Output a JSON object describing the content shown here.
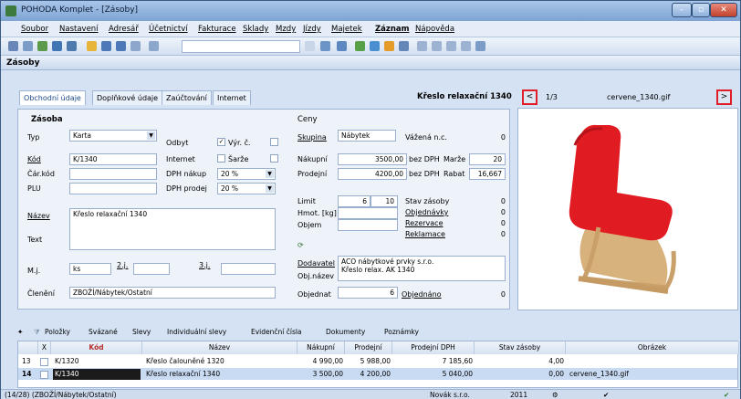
{
  "window": {
    "title": "POHODA Komplet - [Zásoby]"
  },
  "menu": [
    "Soubor",
    "Nastavení",
    "Adresář",
    "Účetnictví",
    "Fakturace",
    "Sklady",
    "Mzdy",
    "Jízdy",
    "Majetek",
    "Záznam",
    "Nápověda"
  ],
  "agenda": {
    "title": "Zásoby"
  },
  "tabs": [
    "Obchodní údaje",
    "Doplňkové údaje",
    "Zaúčtování",
    "Internet"
  ],
  "item_title": "Křeslo relaxační 1340",
  "nav": {
    "prev": "<",
    "counter": "1/3",
    "file": "cervene_1340.gif",
    "next": ">"
  },
  "zasoba": {
    "section": "Zásoba",
    "typ_label": "Typ",
    "typ_value": "Karta",
    "kod_label": "Kód",
    "kod_value": "K/1340",
    "carkod_label": "Čár.kód",
    "plu_label": "PLU",
    "odbyt_label": "Odbyt",
    "vyr_label": "Výr. č.",
    "internet_label": "Internet",
    "sarze_label": "Šarže",
    "dph_nakup_label": "DPH nákup",
    "dph_nakup_value": "20 %",
    "dph_prodej_label": "DPH prodej",
    "dph_prodej_value": "20 %",
    "nazev_label": "Název",
    "nazev_value": "Křeslo relaxační 1340",
    "text_label": "Text",
    "mj_label": "M.j.",
    "mj_value": "ks",
    "mj2_label": "2.j.",
    "mj3_label": "3.j.",
    "cleneni_label": "Členění",
    "cleneni_value": "ZBOŽÍ/Nábytek/Ostatní"
  },
  "ceny": {
    "section": "Ceny",
    "skupina_label": "Skupina",
    "skupina_value": "Nábytek",
    "vazena_label": "Vážená n.c.",
    "vazena_value": "0",
    "nakupni_label": "Nákupní",
    "nakupni_value": "3500,00",
    "bez_dph1": "bez DPH",
    "marze_label": "Marže",
    "marze_value": "20",
    "prodejni_label": "Prodejní",
    "prodejni_value": "4200,00",
    "bez_dph2": "bez DPH",
    "rabat_label": "Rabat",
    "rabat_value": "16,667",
    "limit_label": "Limit",
    "limit_min": "6",
    "limit_max": "10",
    "hmot_label": "Hmot. [kg]",
    "objem_label": "Objem",
    "stav_label": "Stav zásoby",
    "stav_value": "0",
    "objednavky_label": "Objednávky",
    "objednavky_value": "0",
    "rezervace_label": "Rezervace",
    "rezervace_value": "0",
    "reklamace_label": "Reklamace",
    "reklamace_value": "0",
    "dodavatel_label": "Dodavatel",
    "dodavatel_value": "ACO nábytkové prvky s.r.o.",
    "objnazev_label": "Obj.název",
    "objnazev_value": "Křeslo relax. AK 1340",
    "objednat_label": "Objednat",
    "objednat_value": "6",
    "objednano_label": "Objednáno",
    "objednano_value": "0"
  },
  "bottom_tabs": [
    "Položky",
    "Svázané",
    "Slevy",
    "Individuální slevy",
    "Evidenční čísla",
    "Dokumenty",
    "Poznámky"
  ],
  "grid": {
    "headers": [
      "X",
      "Kód",
      "Název",
      "Nákupní",
      "Prodejní",
      "Prodejní DPH",
      "Stav zásoby",
      "Obrázek"
    ],
    "rows": [
      {
        "num": "13",
        "kod": "K/1320",
        "nazev": "Křeslo čalouněné 1320",
        "nakupni": "4 990,00",
        "prodejni": "5 988,00",
        "prodejni_dph": "7 185,60",
        "stav": "4,00",
        "obrazek": ""
      },
      {
        "num": "14",
        "kod": "K/1340",
        "nazev": "Křeslo relaxační 1340",
        "nakupni": "3 500,00",
        "prodejni": "4 200,00",
        "prodejni_dph": "5 040,00",
        "stav": "0,00",
        "obrazek": "cervene_1340.gif"
      }
    ]
  },
  "status": {
    "left": "(14/28) (ZBOŽÍ/Nábytek/Ostatní)",
    "company": "Novák s.r.o.",
    "year": "2011"
  }
}
